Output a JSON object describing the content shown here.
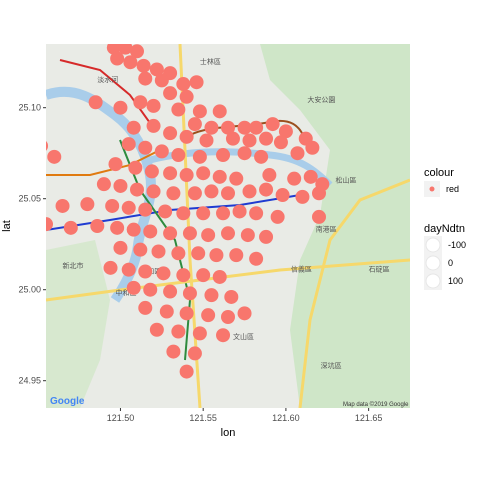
{
  "chart_data": {
    "type": "scatter",
    "title": "",
    "xlabel": "lon",
    "ylabel": "lat",
    "xlim": [
      121.455,
      121.675
    ],
    "ylim": [
      24.935,
      25.135
    ],
    "x_ticks": [
      {
        "value": 121.5,
        "label": "121.50"
      },
      {
        "value": 121.55,
        "label": "121.55"
      },
      {
        "value": 121.6,
        "label": "121.60"
      },
      {
        "value": 121.65,
        "label": "121.65"
      }
    ],
    "y_ticks": [
      {
        "value": 24.95,
        "label": "24.95"
      },
      {
        "value": 25.0,
        "label": "25.00"
      },
      {
        "value": 25.05,
        "label": "25.05"
      },
      {
        "value": 25.1,
        "label": "25.10"
      }
    ],
    "point_color": "#f8766d",
    "basemap": "Google road map (Taipei)",
    "points": [
      [
        121.496,
        25.133
      ],
      [
        121.503,
        25.133
      ],
      [
        121.51,
        25.131
      ],
      [
        121.498,
        25.127
      ],
      [
        121.506,
        25.125
      ],
      [
        121.514,
        25.123
      ],
      [
        121.522,
        25.121
      ],
      [
        121.53,
        25.119
      ],
      [
        121.515,
        25.116
      ],
      [
        121.525,
        25.115
      ],
      [
        121.538,
        25.113
      ],
      [
        121.546,
        25.114
      ],
      [
        121.53,
        25.108
      ],
      [
        121.54,
        25.106
      ],
      [
        121.485,
        25.103
      ],
      [
        121.5,
        25.1
      ],
      [
        121.512,
        25.103
      ],
      [
        121.52,
        25.101
      ],
      [
        121.535,
        25.099
      ],
      [
        121.548,
        25.098
      ],
      [
        121.56,
        25.098
      ],
      [
        121.545,
        25.091
      ],
      [
        121.555,
        25.089
      ],
      [
        121.565,
        25.089
      ],
      [
        121.575,
        25.089
      ],
      [
        121.582,
        25.089
      ],
      [
        121.592,
        25.091
      ],
      [
        121.6,
        25.087
      ],
      [
        121.508,
        25.089
      ],
      [
        121.52,
        25.09
      ],
      [
        121.53,
        25.086
      ],
      [
        121.54,
        25.084
      ],
      [
        121.552,
        25.082
      ],
      [
        121.568,
        25.083
      ],
      [
        121.578,
        25.082
      ],
      [
        121.588,
        25.083
      ],
      [
        121.597,
        25.081
      ],
      [
        121.612,
        25.083
      ],
      [
        121.505,
        25.08
      ],
      [
        121.515,
        25.078
      ],
      [
        121.525,
        25.076
      ],
      [
        121.535,
        25.074
      ],
      [
        121.548,
        25.073
      ],
      [
        121.562,
        25.074
      ],
      [
        121.575,
        25.075
      ],
      [
        121.585,
        25.073
      ],
      [
        121.607,
        25.075
      ],
      [
        121.616,
        25.078
      ],
      [
        121.452,
        25.079
      ],
      [
        121.46,
        25.073
      ],
      [
        121.497,
        25.069
      ],
      [
        121.509,
        25.067
      ],
      [
        121.519,
        25.065
      ],
      [
        121.53,
        25.064
      ],
      [
        121.54,
        25.063
      ],
      [
        121.55,
        25.064
      ],
      [
        121.56,
        25.062
      ],
      [
        121.57,
        25.061
      ],
      [
        121.59,
        25.063
      ],
      [
        121.605,
        25.061
      ],
      [
        121.615,
        25.062
      ],
      [
        121.622,
        25.058
      ],
      [
        121.49,
        25.058
      ],
      [
        121.5,
        25.057
      ],
      [
        121.51,
        25.055
      ],
      [
        121.52,
        25.054
      ],
      [
        121.532,
        25.053
      ],
      [
        121.545,
        25.053
      ],
      [
        121.555,
        25.054
      ],
      [
        121.565,
        25.053
      ],
      [
        121.578,
        25.054
      ],
      [
        121.588,
        25.055
      ],
      [
        121.598,
        25.052
      ],
      [
        121.61,
        25.051
      ],
      [
        121.62,
        25.053
      ],
      [
        121.465,
        25.046
      ],
      [
        121.48,
        25.047
      ],
      [
        121.495,
        25.046
      ],
      [
        121.505,
        25.045
      ],
      [
        121.515,
        25.044
      ],
      [
        121.527,
        25.043
      ],
      [
        121.538,
        25.042
      ],
      [
        121.55,
        25.042
      ],
      [
        121.562,
        25.042
      ],
      [
        121.572,
        25.043
      ],
      [
        121.582,
        25.042
      ],
      [
        121.595,
        25.04
      ],
      [
        121.62,
        25.04
      ],
      [
        121.455,
        25.036
      ],
      [
        121.47,
        25.034
      ],
      [
        121.486,
        25.035
      ],
      [
        121.498,
        25.034
      ],
      [
        121.508,
        25.033
      ],
      [
        121.518,
        25.032
      ],
      [
        121.53,
        25.031
      ],
      [
        121.542,
        25.031
      ],
      [
        121.553,
        25.03
      ],
      [
        121.565,
        25.031
      ],
      [
        121.577,
        25.03
      ],
      [
        121.588,
        25.029
      ],
      [
        121.5,
        25.023
      ],
      [
        121.512,
        25.022
      ],
      [
        121.523,
        25.021
      ],
      [
        121.535,
        25.02
      ],
      [
        121.547,
        25.02
      ],
      [
        121.558,
        25.019
      ],
      [
        121.57,
        25.019
      ],
      [
        121.582,
        25.017
      ],
      [
        121.494,
        25.012
      ],
      [
        121.505,
        25.011
      ],
      [
        121.515,
        25.01
      ],
      [
        121.526,
        25.009
      ],
      [
        121.538,
        25.008
      ],
      [
        121.55,
        25.008
      ],
      [
        121.56,
        25.007
      ],
      [
        121.508,
        25.001
      ],
      [
        121.518,
        25.0
      ],
      [
        121.53,
        24.999
      ],
      [
        121.542,
        24.998
      ],
      [
        121.555,
        24.997
      ],
      [
        121.567,
        24.996
      ],
      [
        121.515,
        24.99
      ],
      [
        121.528,
        24.988
      ],
      [
        121.54,
        24.987
      ],
      [
        121.553,
        24.986
      ],
      [
        121.565,
        24.985
      ],
      [
        121.575,
        24.987
      ],
      [
        121.522,
        24.978
      ],
      [
        121.535,
        24.977
      ],
      [
        121.548,
        24.976
      ],
      [
        121.562,
        24.975
      ],
      [
        121.532,
        24.966
      ],
      [
        121.545,
        24.965
      ],
      [
        121.54,
        24.955
      ]
    ]
  },
  "legend": {
    "colour_title": "colour",
    "colour_items": [
      {
        "label": "red",
        "color": "#f8766d"
      }
    ],
    "size_title": "dayNdtn",
    "size_items": [
      {
        "label": "-100"
      },
      {
        "label": "0"
      },
      {
        "label": "100"
      }
    ]
  },
  "map": {
    "google_logo": "Google",
    "credit": "Map data ©2019 Google",
    "labels": [
      {
        "text": "新北市",
        "lon": 121.465,
        "lat": 25.012
      },
      {
        "text": "大安公園",
        "lon": 121.613,
        "lat": 25.103
      },
      {
        "text": "松山區",
        "lon": 121.63,
        "lat": 25.059
      },
      {
        "text": "南港區",
        "lon": 121.618,
        "lat": 25.032
      },
      {
        "text": "信義區",
        "lon": 121.603,
        "lat": 25.01
      },
      {
        "text": "石碇區",
        "lon": 121.65,
        "lat": 25.01
      },
      {
        "text": "中和區",
        "lon": 121.497,
        "lat": 24.997
      },
      {
        "text": "永和區",
        "lon": 121.512,
        "lat": 25.009
      },
      {
        "text": "文山區",
        "lon": 121.568,
        "lat": 24.973
      },
      {
        "text": "淡水河",
        "lon": 121.486,
        "lat": 25.114
      },
      {
        "text": "士林區",
        "lon": 121.548,
        "lat": 25.124
      },
      {
        "text": "深坑區",
        "lon": 121.621,
        "lat": 24.957
      }
    ]
  }
}
